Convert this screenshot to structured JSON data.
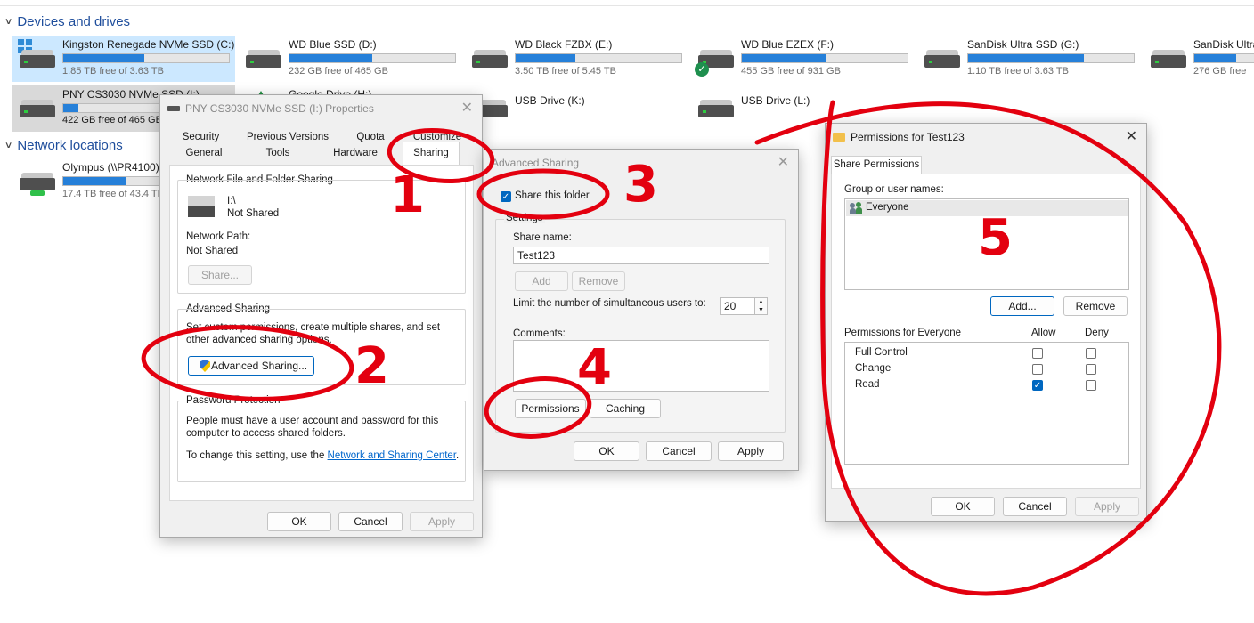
{
  "explorer": {
    "devices_header": "Devices and drives",
    "network_header": "Network locations",
    "drives": [
      {
        "name": "Kingston Renegade NVMe SSD (C:)",
        "free": "1.85 TB free of 3.63 TB",
        "used_fraction": 0.49
      },
      {
        "name": "WD Blue SSD (D:)",
        "free": "232 GB free of 465 GB",
        "used_fraction": 0.5
      },
      {
        "name": "WD Black FZBX (E:)",
        "free": "3.50 TB free of 5.45 TB",
        "used_fraction": 0.36
      },
      {
        "name": "WD Blue EZEX (F:)",
        "free": "455 GB free of 931 GB",
        "used_fraction": 0.51
      },
      {
        "name": "SanDisk Ultra SSD (G:)",
        "free": "1.10 TB free of 3.63 TB",
        "used_fraction": 0.7
      },
      {
        "name": "SanDisk Ultra",
        "free": "276 GB free",
        "used_fraction": 0.6
      },
      {
        "name": "PNY CS3030 NVMe SSD (I:)",
        "free": "422 GB free of 465 GB",
        "used_fraction": 0.09
      },
      {
        "name": "Google Drive (H:)",
        "free": "",
        "used_fraction": 0
      },
      {
        "name": "USB Drive (K:)",
        "free": "",
        "used_fraction": 0
      },
      {
        "name": "USB Drive (L:)",
        "free": "",
        "used_fraction": 0
      }
    ],
    "network": [
      {
        "name": "Olympus (\\\\PR4100)",
        "free": "17.4 TB free of 43.4 TB",
        "used_fraction": 0.6
      }
    ]
  },
  "properties": {
    "title": "PNY CS3030 NVMe SSD (I:) Properties",
    "tabs_row1": [
      "Security",
      "Previous Versions",
      "Quota",
      "Customize"
    ],
    "tabs_row2": [
      "General",
      "Tools",
      "Hardware",
      "Sharing"
    ],
    "nffs_title": "Network File and Folder Sharing",
    "drive_path": "I:\\",
    "drive_status": "Not Shared",
    "network_path_label": "Network Path:",
    "network_path_value": "Not Shared",
    "share_button": "Share...",
    "adv_title": "Advanced Sharing",
    "adv_desc": "Set custom permissions, create multiple shares, and set other advanced sharing options.",
    "adv_button": "Advanced Sharing...",
    "pw_title": "Password Protection",
    "pw_desc": "People must have a user account and password for this computer to access shared folders.",
    "pw_change_prefix": "To change this setting, use the ",
    "pw_link": "Network and Sharing Center",
    "pw_suffix": ".",
    "ok": "OK",
    "cancel": "Cancel",
    "apply": "Apply"
  },
  "advanced": {
    "title": "Advanced Sharing",
    "share_checkbox": "Share this folder",
    "settings_label": "Settings",
    "share_name_label": "Share name:",
    "share_name_value": "Test123",
    "add": "Add",
    "remove": "Remove",
    "limit_label": "Limit the number of simultaneous users to:",
    "limit_value": "20",
    "comments_label": "Comments:",
    "permissions": "Permissions",
    "caching": "Caching",
    "ok": "OK",
    "cancel": "Cancel",
    "apply": "Apply"
  },
  "perms": {
    "title": "Permissions for Test123",
    "tab": "Share Permissions",
    "group_label": "Group or user names:",
    "users": [
      "Everyone"
    ],
    "add": "Add...",
    "remove": "Remove",
    "perm_header": "Permissions for Everyone",
    "allow": "Allow",
    "deny": "Deny",
    "rows": [
      {
        "name": "Full Control",
        "allow": false,
        "deny": false
      },
      {
        "name": "Change",
        "allow": false,
        "deny": false
      },
      {
        "name": "Read",
        "allow": true,
        "deny": false
      }
    ],
    "ok": "OK",
    "cancel": "Cancel",
    "apply": "Apply"
  },
  "annotations": [
    "1",
    "2",
    "3",
    "4",
    "5"
  ],
  "colors": {
    "annotation": "#e3000f",
    "accent": "#0067c0",
    "bar": "#2680d9"
  }
}
